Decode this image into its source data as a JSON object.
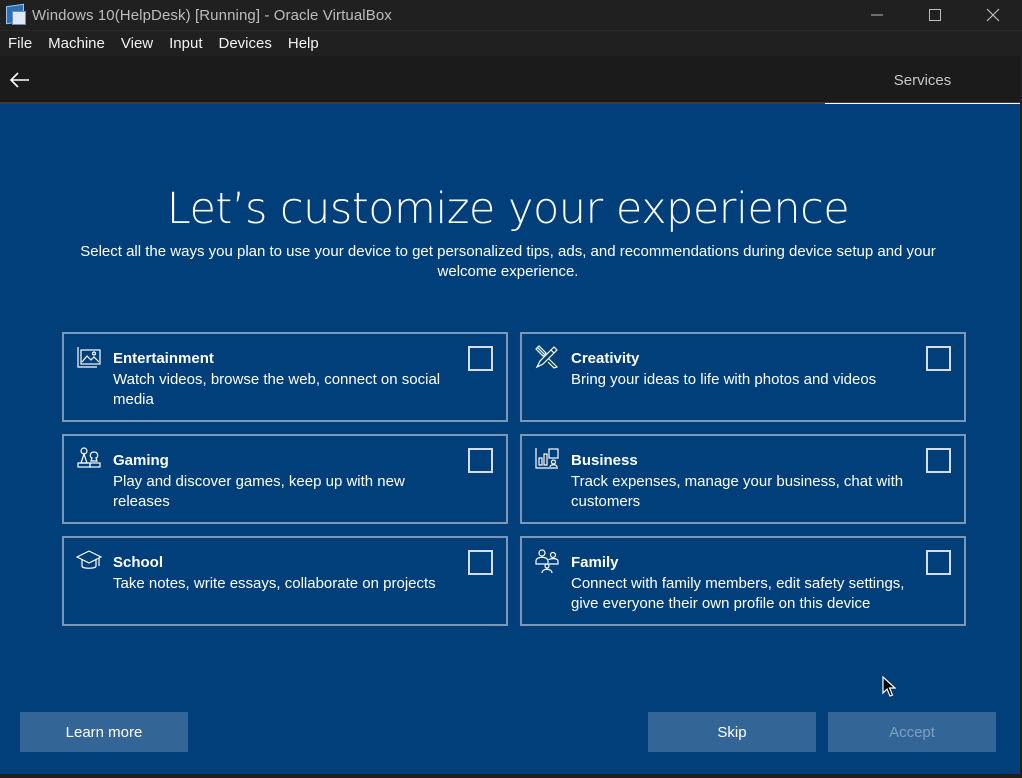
{
  "window": {
    "title": "Windows 10(HelpDesk) [Running] - Oracle VirtualBox",
    "app_icon": "virtualbox-icon",
    "controls": [
      "minimize-icon",
      "maximize-icon",
      "close-icon"
    ]
  },
  "menu": {
    "items": [
      "File",
      "Machine",
      "View",
      "Input",
      "Devices",
      "Help"
    ]
  },
  "header": {
    "back_icon": "back-arrow-icon",
    "section_label": "Services"
  },
  "page": {
    "title": "Let’s customize your experience",
    "subtitle": "Select all the ways you plan to use your device to get personalized tips, ads, and recommendations during device setup and your welcome experience."
  },
  "cards": [
    {
      "icon": "entertainment-icon",
      "title": "Entertainment",
      "description": "Watch videos, browse the web, connect on social media",
      "checked": false
    },
    {
      "icon": "creativity-icon",
      "title": "Creativity",
      "description": "Bring your ideas to life with photos and videos",
      "checked": false
    },
    {
      "icon": "gaming-icon",
      "title": "Gaming",
      "description": "Play and discover games, keep up with new releases",
      "checked": false
    },
    {
      "icon": "business-icon",
      "title": "Business",
      "description": "Track expenses, manage your business, chat with customers",
      "checked": false
    },
    {
      "icon": "school-icon",
      "title": "School",
      "description": "Take notes, write essays, collaborate on projects",
      "checked": false
    },
    {
      "icon": "family-icon",
      "title": "Family",
      "description": "Connect with family members, edit safety settings, give everyone their own profile on this device",
      "checked": false
    }
  ],
  "buttons": {
    "learn_more": "Learn more",
    "skip": "Skip",
    "accept": "Accept"
  },
  "colors": {
    "background": "#003f7a",
    "button": "#336697",
    "card_border": "#7b98b6",
    "titlebar": "#202020"
  }
}
